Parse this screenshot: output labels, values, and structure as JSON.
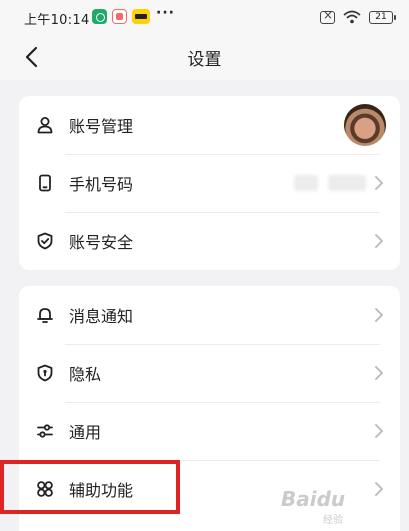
{
  "status_bar": {
    "time": "上午10:14",
    "more": "···",
    "battery": "21",
    "app_icons": [
      "app-green-icon",
      "app-red-icon",
      "meituan-icon"
    ],
    "indicators": [
      "sim-off-icon",
      "wifi-icon",
      "battery-icon"
    ]
  },
  "header": {
    "title": "设置",
    "back_icon": "chevron-left-icon"
  },
  "account_section": {
    "items": [
      {
        "label": "账号管理",
        "icon": "person-icon",
        "trailing": "avatar"
      },
      {
        "label": "手机号码",
        "icon": "phone-icon",
        "trailing": "chevron"
      },
      {
        "label": "账号安全",
        "icon": "shield-check-icon",
        "trailing": "chevron"
      }
    ]
  },
  "general_section": {
    "items": [
      {
        "label": "消息通知",
        "icon": "bell-icon",
        "trailing": "chevron"
      },
      {
        "label": "隐私",
        "icon": "shield-lock-icon",
        "trailing": "chevron"
      },
      {
        "label": "通用",
        "icon": "sliders-icon",
        "trailing": "chevron"
      },
      {
        "label": "辅助功能",
        "icon": "grid-clover-icon",
        "trailing": "chevron"
      }
    ]
  },
  "annotation": {
    "highlight_color": "#e02424",
    "highlighted_item": "辅助功能"
  },
  "watermark": {
    "text": "Baidu",
    "sub": "经验"
  },
  "colors": {
    "page_background": "#f2f2f4",
    "card_background": "#ffffff",
    "text": "#222222",
    "chevron": "#b8b8b8"
  }
}
